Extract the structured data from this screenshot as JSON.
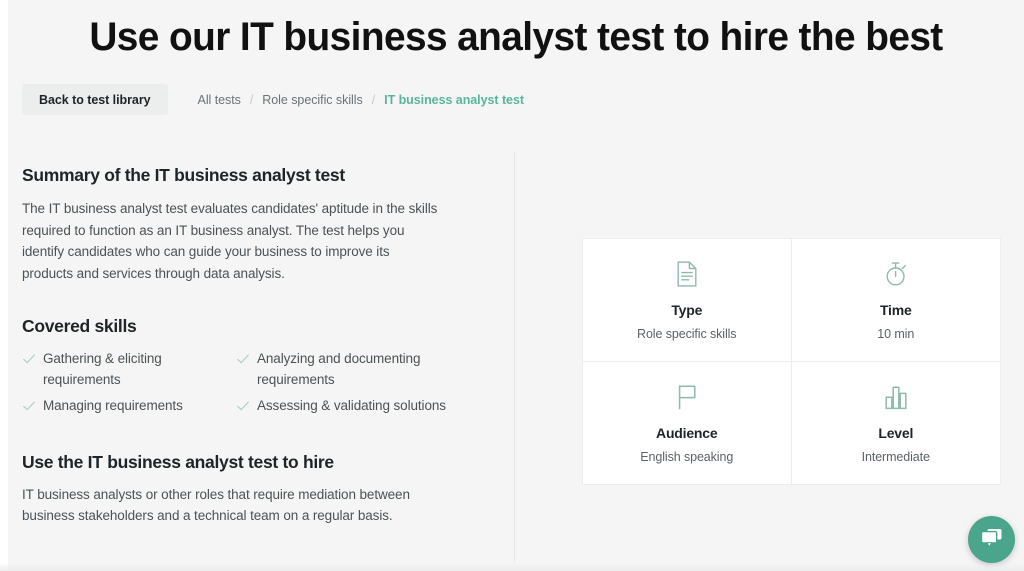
{
  "page": {
    "title": "Use our IT business analyst test to hire the best",
    "accent_color": "#58b69c",
    "icon_color": "#8fb9ac",
    "chat_color": "#4aa58c"
  },
  "nav": {
    "back_button": "Back to test library",
    "breadcrumb": [
      {
        "label": "All tests",
        "current": false
      },
      {
        "label": "Role specific skills",
        "current": false
      },
      {
        "label": "IT business analyst test",
        "current": true
      }
    ],
    "separator": "/"
  },
  "summary": {
    "heading": "Summary of the IT business analyst test",
    "body": "The IT business analyst test evaluates candidates' aptitude in the skills required to function as an IT business analyst. The test helps you identify candidates who can guide your business to improve its products and services through data analysis."
  },
  "covered_skills": {
    "heading": "Covered skills",
    "items": [
      "Gathering & eliciting requirements",
      "Analyzing and documenting requirements",
      "Managing requirements",
      "Assessing & validating solutions"
    ]
  },
  "hire": {
    "heading": "Use the IT business analyst test to hire",
    "body": "IT business analysts or other roles that require mediation between business stakeholders and a technical team on a regular basis."
  },
  "info_cards": [
    {
      "icon": "document-icon",
      "label": "Type",
      "value": "Role specific skills"
    },
    {
      "icon": "stopwatch-icon",
      "label": "Time",
      "value": "10 min"
    },
    {
      "icon": "flag-icon",
      "label": "Audience",
      "value": "English speaking"
    },
    {
      "icon": "bar-chart-icon",
      "label": "Level",
      "value": "Intermediate"
    }
  ],
  "chat": {
    "icon": "chat-bubbles-icon",
    "aria_label": "Open chat"
  }
}
